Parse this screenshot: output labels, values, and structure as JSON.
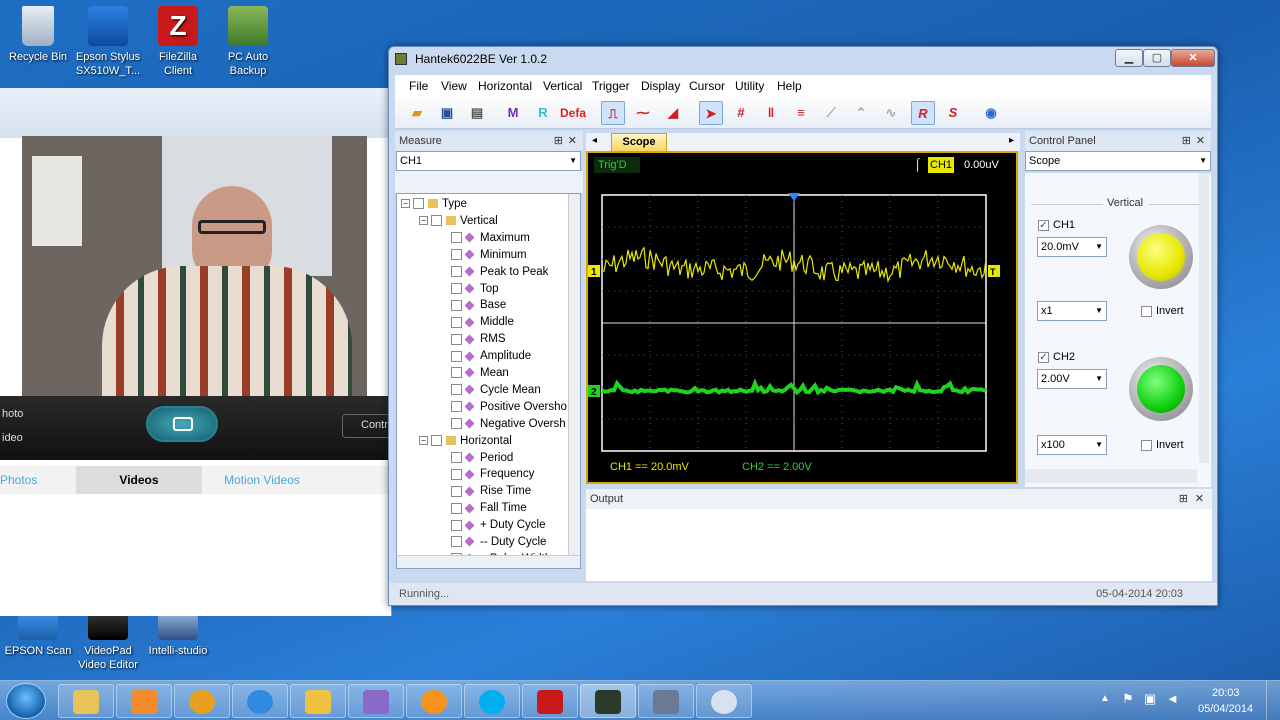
{
  "desktop": {
    "icons": [
      {
        "label1": "Recycle Bin",
        "label2": ""
      },
      {
        "label1": "Epson Stylus",
        "label2": "SX510W_T..."
      },
      {
        "label1": "FileZilla",
        "label2": "Client"
      },
      {
        "label1": "PC Auto",
        "label2": "Backup"
      }
    ],
    "bottom_icons": [
      {
        "label1": "EPSON Scan",
        "label2": ""
      },
      {
        "label1": "VideoPad",
        "label2": "Video Editor"
      },
      {
        "label1": "Intelli-studio",
        "label2": ""
      }
    ]
  },
  "camera_app": {
    "photo_label": "hoto",
    "video_label": "ideo",
    "control_label": "Contr",
    "tabs": [
      "Photos",
      "Videos",
      "Motion Videos"
    ]
  },
  "hantek": {
    "title": "Hantek6022BE Ver 1.0.2",
    "menu": [
      "File",
      "View",
      "Horizontal",
      "Vertical",
      "Trigger",
      "Display",
      "Cursor",
      "Utility",
      "Help"
    ],
    "toolbar_defa": "Defa",
    "measure": {
      "header": "Measure",
      "channel": "CH1",
      "tree_root": "Type",
      "vertical_group": "Vertical",
      "vertical_items": [
        "Maximum",
        "Minimum",
        "Peak to Peak",
        "Top",
        "Base",
        "Middle",
        "RMS",
        "Amplitude",
        "Mean",
        "Cycle Mean",
        "Positive Oversho",
        "Negative Oversh"
      ],
      "horizontal_group": "Horizontal",
      "horizontal_items": [
        "Period",
        "Frequency",
        "Rise Time",
        "Fall Time",
        "+ Duty Cycle",
        "-- Duty Cycle",
        "+ Pulse Width"
      ]
    },
    "scope": {
      "tab": "Scope",
      "trig_status": "Trig'D",
      "trig_channel": "CH1",
      "trig_level": "0.00uV",
      "ch1_readout": "CH1 ==  20.0mV",
      "ch2_readout": "CH2 ==  2.00V",
      "ch1_marker": "1",
      "ch2_marker": "2",
      "trigger_marker": "T"
    },
    "control_panel": {
      "header": "Control Panel",
      "mode": "Scope",
      "section": "Vertical",
      "ch1": {
        "label": "CH1",
        "volts": "20.0mV",
        "probe": "x1",
        "invert": "Invert",
        "color": "#ffff00"
      },
      "ch2": {
        "label": "CH2",
        "volts": "2.00V",
        "probe": "x100",
        "invert": "Invert",
        "color": "#00ee00"
      }
    },
    "output_header": "Output",
    "status_left": "Running...",
    "status_right": "05-04-2014  20:03"
  },
  "taskbar": {
    "time": "20:03",
    "date": "05/04/2014"
  },
  "colors": {
    "trace1": "#e8e800",
    "trace2": "#1fd31f",
    "scope_frame": "#d8a800"
  }
}
